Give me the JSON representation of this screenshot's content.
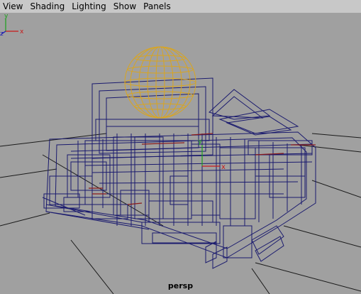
{
  "menubar": {
    "items": [
      {
        "label": "View"
      },
      {
        "label": "Shading"
      },
      {
        "label": "Lighting"
      },
      {
        "label": "Show"
      },
      {
        "label": "Panels"
      }
    ]
  },
  "viewport": {
    "camera_label": "persp",
    "background_color": "#a0a0a0",
    "grid_color": "#1a1a1a",
    "wireframe_color": "#1a1a6e",
    "selected_sphere_color": "#d9a520",
    "highlight_color": "#8b1a1a"
  },
  "axis_gizmo": {
    "x_label": "x",
    "y_label": "y",
    "z_label": "z"
  },
  "pivot": {
    "x_label": "x",
    "y_label": "y"
  }
}
